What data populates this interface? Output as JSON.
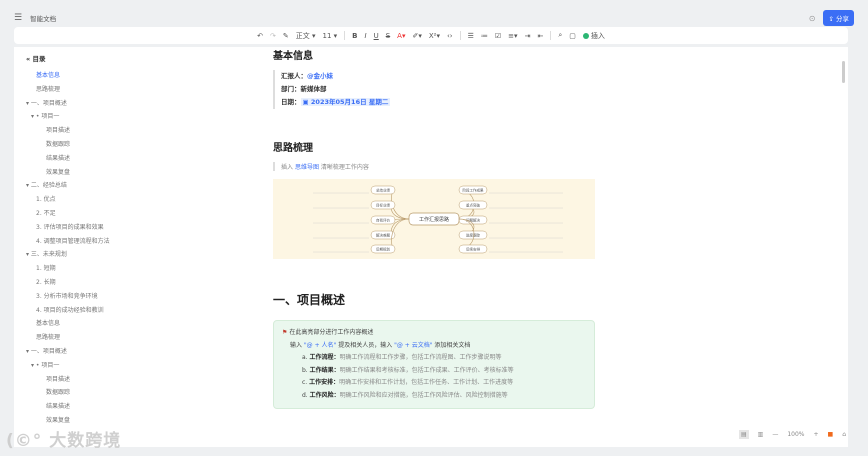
{
  "header": {
    "title": "智能文档",
    "share_label": "分享"
  },
  "toolbar": {
    "style": "正文",
    "font_size": "11",
    "insert_label": "插入"
  },
  "sidebar": {
    "heading": "目录",
    "items": [
      {
        "label": "基本信息",
        "indent": 1,
        "active": true
      },
      {
        "label": "思路梳理",
        "indent": 1
      },
      {
        "label": "▾ 一、项目概述",
        "indent": 0
      },
      {
        "label": "▾ • 项目一",
        "indent": 0.5
      },
      {
        "label": "项目描述",
        "indent": 2
      },
      {
        "label": "数据跟踪",
        "indent": 2
      },
      {
        "label": "结果描述",
        "indent": 2
      },
      {
        "label": "效果复盘",
        "indent": 2
      },
      {
        "label": "▾ 二、经验总结",
        "indent": 0
      },
      {
        "label": "1. 优点",
        "indent": 1
      },
      {
        "label": "2. 不足",
        "indent": 1
      },
      {
        "label": "3. 评估项目的成果和效果",
        "indent": 1
      },
      {
        "label": "4. 调整项目管理流程和方法",
        "indent": 1
      },
      {
        "label": "▾ 三、未来规划",
        "indent": 0
      },
      {
        "label": "1. 短期",
        "indent": 1
      },
      {
        "label": "2. 长期",
        "indent": 1
      },
      {
        "label": "3. 分析市场和竞争环境",
        "indent": 1
      },
      {
        "label": "4. 项目的成功经验和教训",
        "indent": 1
      },
      {
        "label": "基本信息",
        "indent": 1
      },
      {
        "label": "思路梳理",
        "indent": 1
      },
      {
        "label": "▾ 一、项目概述",
        "indent": 0
      },
      {
        "label": "▾ • 项目一",
        "indent": 0.5
      },
      {
        "label": "项目描述",
        "indent": 2
      },
      {
        "label": "数据跟踪",
        "indent": 2
      },
      {
        "label": "结果描述",
        "indent": 2
      },
      {
        "label": "效果复盘",
        "indent": 2
      }
    ]
  },
  "doc": {
    "basic_title": "基本信息",
    "reporter_label": "汇报人：",
    "reporter": "@金小妹",
    "dept_label": "部门：",
    "dept": "新媒体部",
    "date_label": "日期：",
    "date": "2023年05月16日 星期二",
    "idea_title": "思路梳理",
    "idea_pre": "插入",
    "idea_link": "思维导图",
    "idea_post": "清晰梳理工作内容",
    "mindmap_center": "工作汇报思路",
    "mindmap_left": [
      "总结业绩",
      "目标业绩",
      "自我评价",
      "解决难题",
      "后期规划"
    ],
    "mindmap_right": [
      "阶段工作成果",
      "重点突破",
      "问题解决",
      "进度跟踪",
      "后续安排"
    ],
    "section1_title": "一、项目概述",
    "callout_title": "在此高亮部分进行工作内容概述",
    "callout_line_pre": "输入 ",
    "callout_at_name": "\"@ + 人名\"",
    "callout_line_mid": " 提及相关人员，输入 ",
    "callout_at_doc": "\"@ + 云文档\"",
    "callout_line_post": " 添加相关文档",
    "list": [
      {
        "marker": "a.",
        "title": "工作流程：",
        "desc": "明确工作流程和工作步骤，包括工作流程图、工作步骤说明等"
      },
      {
        "marker": "b.",
        "title": "工作结果：",
        "desc": "明确工作结果和考核标准，包括工作成果、工作评价、考核标准等"
      },
      {
        "marker": "c.",
        "title": "工作安排：",
        "desc": "明确工作安排和工作计划，包括工作任务、工作计划、工作进度等"
      },
      {
        "marker": "d.",
        "title": "工作风险：",
        "desc": "明确工作风险和应对措施，包括工作风险评估、风险控制措施等"
      }
    ]
  },
  "footer": {
    "zoom": "100%"
  },
  "watermark": "大数跨境"
}
